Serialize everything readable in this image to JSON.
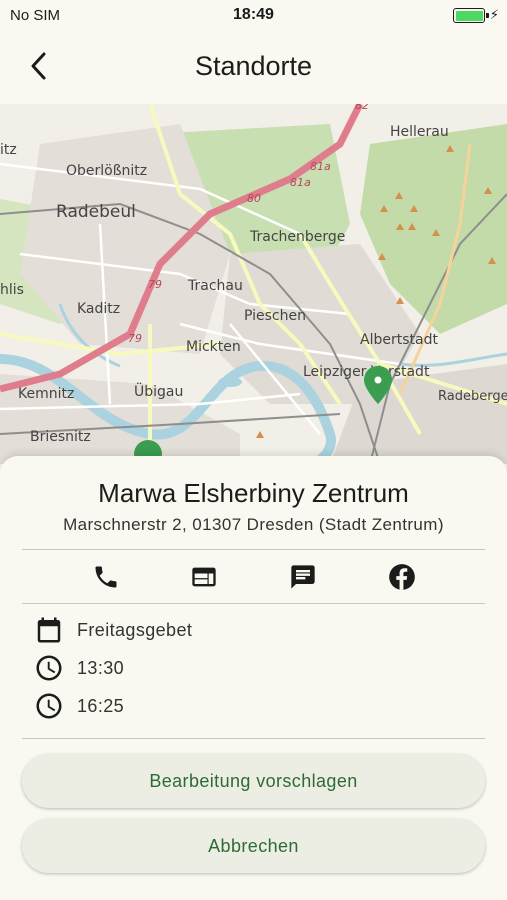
{
  "status_bar": {
    "carrier": "No SIM",
    "time": "18:49",
    "battery_level": 1.0
  },
  "nav": {
    "title": "Standorte"
  },
  "map": {
    "labels": [
      "Hellerau",
      "Oberlößnitz",
      "Radebeul",
      "Trachenberge",
      "Trachau",
      "Kaditz",
      "Pieschen",
      "Mickten",
      "Albertstadt",
      "Leipziger Vorstadt",
      "Radeberger Vorstadt",
      "Übigau",
      "Kemnitz",
      "Briesnitz",
      "hlis",
      "itz"
    ],
    "road_shields": [
      "81a",
      "81a",
      "80",
      "79",
      "79",
      "82"
    ]
  },
  "sheet": {
    "name": "Marwa Elsherbiny Zentrum",
    "address": "Marschnerstr 2, 01307 Dresden (Stadt Zentrum)",
    "info": [
      {
        "icon": "calendar-icon",
        "text": "Freitagsgebet"
      },
      {
        "icon": "clock-icon",
        "text": "13:30"
      },
      {
        "icon": "clock-icon",
        "text": "16:25"
      }
    ],
    "suggest_edit_label": "Bearbeitung vorschlagen",
    "cancel_label": "Abbrechen"
  },
  "colors": {
    "accent": "#2e6b34",
    "marker": "#3a9d4f",
    "motorway": "#e07d8d"
  }
}
